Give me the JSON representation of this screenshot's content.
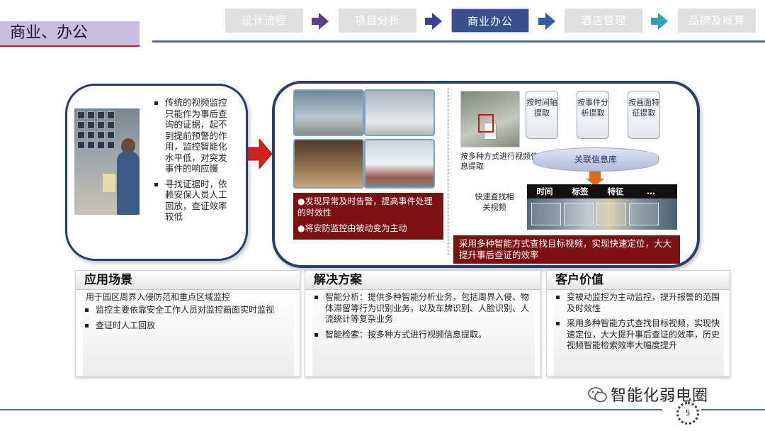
{
  "header": {
    "title": "商业、办公",
    "steps": [
      {
        "label": "设计流程",
        "active": false
      },
      {
        "label": "项目分析",
        "active": false
      },
      {
        "label": "商业办公",
        "active": true
      },
      {
        "label": "酒店管理",
        "active": false
      },
      {
        "label": "品牌及概算",
        "active": false
      }
    ]
  },
  "left_panel": {
    "bullets": [
      "传统的视频监控只能作为事后查询的证据，起不到提前预警的作用，监控智能化水平低，对突发事件的响应慢",
      "寻找证据时，依赖安保人员人工回放，查证效率较低"
    ]
  },
  "solution_panel": {
    "note_left": [
      "●发现异常及时告警，提高事件处理的时效性",
      "●将安防监控由被动变为主动"
    ],
    "road_caption": "按多种方式进行视频信息提取",
    "feature_boxes": [
      "按时间轴提取",
      "按事件分析提取",
      "按画面特征提取"
    ],
    "database_label": "关联信息库",
    "quick_find": "快速查找相关视频",
    "tags": [
      "时间",
      "标签",
      "特征",
      "…"
    ],
    "note_right": "采用多种智能方式查找目标视频，实现快速定位，大大提升事后查证的效率"
  },
  "cards": [
    {
      "title": "应用场景",
      "lead": "用于园区周界入侵防范和重点区域监控",
      "bullets": [
        "监控主要依靠安全工作人员对监控画面实时监视",
        "查证时人工回放"
      ]
    },
    {
      "title": "解决方案",
      "lead": "",
      "bullets": [
        "智能分析：提供多种智能分析业务，包括周界入侵、物体滞留等行为识别业务，以及车牌识别、人脸识别、人流统计等复杂业务",
        "智能检索：按多种方式进行视频信息提取。"
      ]
    },
    {
      "title": "客户价值",
      "lead": "",
      "bullets": [
        "变被动监控为主动监控，提升报警的范围及时效性",
        "采用多种智能方式查找目标视频，实现快速定位，大大提升事后查证的效率，历史视频智能检索效率大幅度提升"
      ]
    }
  ],
  "footer": {
    "brand": "智能化弱电圈",
    "page_number": "5"
  },
  "colors": {
    "accent_purple": "#5a3d8c",
    "active_step": "#3a4f8f",
    "panel_border": "#2a3e6b",
    "note_red": "#7b1010"
  }
}
